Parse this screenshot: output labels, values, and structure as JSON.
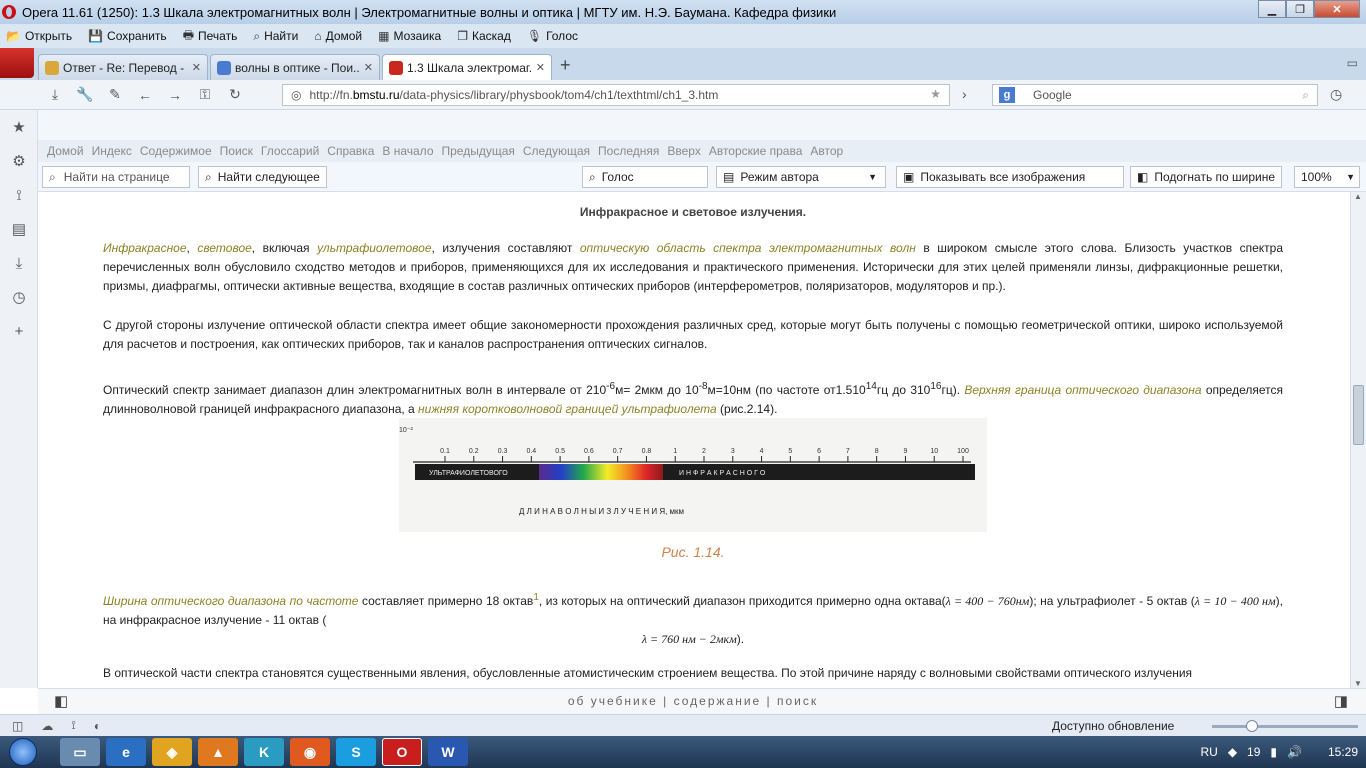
{
  "window": {
    "title": "Opera 11.61 (1250): 1.3 Шкала электромагнитных волн | Электромагнитные волны и оптика | МГТУ им. Н.Э. Баумана. Кафедра физики"
  },
  "menubar": {
    "items": [
      {
        "label": "Открыть",
        "icon": "folder-icon"
      },
      {
        "label": "Сохранить",
        "icon": "save-icon"
      },
      {
        "label": "Печать",
        "icon": "print-icon"
      },
      {
        "label": "Найти",
        "icon": "search-icon"
      },
      {
        "label": "Домой",
        "icon": "home-icon"
      },
      {
        "label": "Мозаика",
        "icon": "tile-icon"
      },
      {
        "label": "Каскад",
        "icon": "cascade-icon"
      },
      {
        "label": "Голос",
        "icon": "voice-icon"
      }
    ]
  },
  "tabs": [
    {
      "label": "Ответ - Re: Перевод - ...",
      "favicon_color": "#d9a73a",
      "active": false
    },
    {
      "label": "волны в оптике - Пои...",
      "favicon_color": "#4a7bd0",
      "active": false
    },
    {
      "label": "1.3 Шкала электромаг...",
      "favicon_color": "#c8281e",
      "active": true
    }
  ],
  "address": {
    "url_prefix": "http://fn.",
    "url_domain": "bmstu.ru",
    "url_path": "/data-physics/library/physbook/tom4/ch1/texthtml/ch1_3.htm",
    "search_placeholder": "Google"
  },
  "navlinks": [
    "Домой",
    "Индекс",
    "Содержимое",
    "Поиск",
    "Глоссарий",
    "Справка",
    "В начало",
    "Предыдущая",
    "Следующая",
    "Последняя",
    "Вверх",
    "Авторские права",
    "Автор"
  ],
  "toolbar": {
    "find_placeholder": "Найти на странице",
    "find_next": "Найти следующее",
    "voice": "Голос",
    "author_mode": "Режим автора",
    "show_images": "Показывать все изображения",
    "fit_width": "Подогнать по ширине",
    "zoom": "100%"
  },
  "article": {
    "title": "Инфракрасное и световое излучения.",
    "p1": {
      "hl1": "Инфракрасное",
      "sep1": ", ",
      "hl2": "световое",
      "t1": ", включая ",
      "hl3": "ультрафиолетовое",
      "t2": ", излучения составляют ",
      "hl4": "оптическую область спектра электромагнитных волн",
      "t3": " в широком смысле этого слова. Близость участков спектра перечисленных волн обусловило сходство методов и приборов, применяющихся для их исследования и практического применения. Исторически для этих целей применяли линзы, дифракционные решетки, призмы, диафрагмы, оптически активные вещества, входящие в состав различных оптических приборов (интерферометров, поляризаторов, модуляторов и пр.)."
    },
    "p2": "С другой стороны излучение оптической области спектра имеет общие закономерности прохождения различных сред, которые могут быть получены с помощью геометрической оптики, широко используемой для расчетов и построения, как оптических приборов, так и каналов распространения оптических сигналов.",
    "p3": {
      "t1": "Оптический спектр занимает диапазон длин электромагнитных волн в интервале от 210",
      "sup1": "-6",
      "t2": "м= 2мкм до 10",
      "sup2": "-8",
      "t3": "м=10нм (по частоте от1.510",
      "sup3": "14",
      "t4": "гц до 310",
      "sup4": "16",
      "t5": "гц). ",
      "hl1": "Верхняя граница оптического диапазона",
      "t6": " определяется длинноволновой границей инфракрасного диапазона, а ",
      "hl2": "нижняя коротковолновой границей ультрафиолета",
      "t7": " (рис.2.14)."
    },
    "figure": {
      "corner_label": "10⁻²",
      "ticks": [
        "0.1",
        "0.2",
        "0.3",
        "0.4",
        "0.5",
        "0.6",
        "0.7",
        "0.8",
        "1",
        "2",
        "3",
        "4",
        "5",
        "6",
        "7",
        "8",
        "9",
        "10",
        "100"
      ],
      "uv_label": "УЛЬТРАФИОЛЕТОВОГО",
      "ir_label": "И Н Ф Р А К Р А С Н О Г О",
      "axis_label": "Д Л И Н А      В О Л Н Ы      И З Л У Ч Е Н И Я, мкм",
      "caption": "Рис. 1.14."
    },
    "p4": {
      "hl1": "Ширина оптического диапазона по частоте",
      "t1": " составляет примерно 18 октав",
      "sup1": "1",
      "t2": ", из которых на оптический диапазон приходится примерно одна октава(",
      "m1": "λ = 400 − 760нм",
      "t3": "); на ультрафиолет - 5 октав (",
      "m2": "λ = 10 − 400 нм",
      "t4": "), на инфракрасное излучение - 11 октав (",
      "m3": "λ = 760 нм − 2мкм",
      "t5": ")."
    },
    "p5": "В оптической части спектра становятся существенными явления, обусловленные атомистическим строением вещества. По этой причине наряду с волновыми свойствами оптического излучения"
  },
  "bottomnav": {
    "about": "об учебнике",
    "contents": "содержание",
    "search": "поиск"
  },
  "statusbar": {
    "update_text": "Доступно обновление"
  },
  "taskbar": {
    "lang": "RU",
    "time": "15:29",
    "calendar_day": "19"
  }
}
